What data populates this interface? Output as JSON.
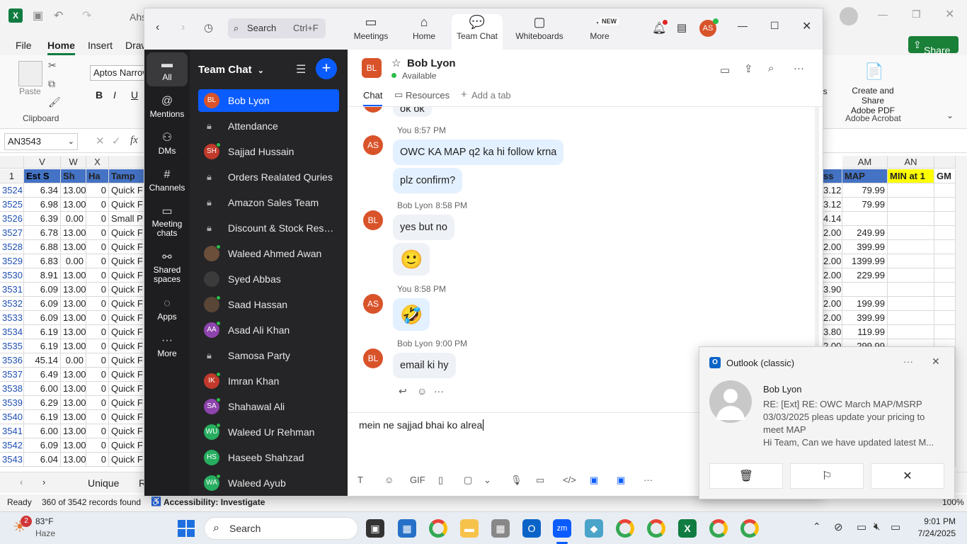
{
  "excel": {
    "title_fragment": "Ahs",
    "tabs": [
      "File",
      "Home",
      "Insert",
      "Draw"
    ],
    "font_name": "Aptos Narrow",
    "clipboard_label": "Clipboard",
    "paste_label": "Paste",
    "name_box": "AN3543",
    "fx_label": "fx",
    "share_label": "Share",
    "pdf_label_1": "Create and Share",
    "pdf_label_2": "Adobe PDF",
    "adobe_group": "Adobe Acrobat",
    "ribbon_right_fragment": "ls",
    "columns_left": [
      "V",
      "W",
      "X"
    ],
    "columns_right": [
      "AM",
      "AN"
    ],
    "header_row_num": "1",
    "headers_left": [
      "Est S",
      "Sh",
      "Ha",
      "Tamp"
    ],
    "headers_right": [
      "ss",
      "MAP",
      "MIN at 1",
      "GM"
    ],
    "rows": [
      {
        "n": "3524",
        "v": "6.34",
        "w": "13.00",
        "x": "0",
        "t": "Quick F",
        "r": "3.12",
        "map": "79.99"
      },
      {
        "n": "3525",
        "v": "6.98",
        "w": "13.00",
        "x": "0",
        "t": "Quick F",
        "r": "3.12",
        "map": "79.99"
      },
      {
        "n": "3526",
        "v": "6.39",
        "w": "0.00",
        "x": "0",
        "t": "Small P",
        "r": "4.14",
        "map": ""
      },
      {
        "n": "3527",
        "v": "6.78",
        "w": "13.00",
        "x": "0",
        "t": "Quick F",
        "r": "2.00",
        "map": "249.99"
      },
      {
        "n": "3528",
        "v": "6.88",
        "w": "13.00",
        "x": "0",
        "t": "Quick F",
        "r": "2.00",
        "map": "399.99"
      },
      {
        "n": "3529",
        "v": "6.83",
        "w": "0.00",
        "x": "0",
        "t": "Quick F",
        "r": "2.00",
        "map": "1399.99"
      },
      {
        "n": "3530",
        "v": "8.91",
        "w": "13.00",
        "x": "0",
        "t": "Quick F",
        "r": "2.00",
        "map": "229.99"
      },
      {
        "n": "3531",
        "v": "6.09",
        "w": "13.00",
        "x": "0",
        "t": "Quick F",
        "r": "3.90",
        "map": ""
      },
      {
        "n": "3532",
        "v": "6.09",
        "w": "13.00",
        "x": "0",
        "t": "Quick F",
        "r": "2.00",
        "map": "199.99"
      },
      {
        "n": "3533",
        "v": "6.09",
        "w": "13.00",
        "x": "0",
        "t": "Quick F",
        "r": "2.00",
        "map": "399.99"
      },
      {
        "n": "3534",
        "v": "6.19",
        "w": "13.00",
        "x": "0",
        "t": "Quick F",
        "r": "3.80",
        "map": "119.99"
      },
      {
        "n": "3535",
        "v": "6.19",
        "w": "13.00",
        "x": "0",
        "t": "Quick F",
        "r": "2.00",
        "map": "299.99"
      },
      {
        "n": "3536",
        "v": "45.14",
        "w": "0.00",
        "x": "0",
        "t": "Quick F",
        "r": "",
        "map": ""
      },
      {
        "n": "3537",
        "v": "6.49",
        "w": "13.00",
        "x": "0",
        "t": "Quick F",
        "r": "",
        "map": ""
      },
      {
        "n": "3538",
        "v": "6.00",
        "w": "13.00",
        "x": "0",
        "t": "Quick F",
        "r": "",
        "map": ""
      },
      {
        "n": "3539",
        "v": "6.29",
        "w": "13.00",
        "x": "0",
        "t": "Quick F",
        "r": "",
        "map": ""
      },
      {
        "n": "3540",
        "v": "6.19",
        "w": "13.00",
        "x": "0",
        "t": "Quick F",
        "r": "",
        "map": ""
      },
      {
        "n": "3541",
        "v": "6.00",
        "w": "13.00",
        "x": "0",
        "t": "Quick F",
        "r": "",
        "map": ""
      },
      {
        "n": "3542",
        "v": "6.09",
        "w": "13.00",
        "x": "0",
        "t": "Quick F",
        "r": "",
        "map": ""
      },
      {
        "n": "3543",
        "v": "6.04",
        "w": "13.00",
        "x": "0",
        "t": "Quick F",
        "r": "",
        "map": ""
      }
    ],
    "sheet_tab_1": "Unique",
    "sheet_tab_2": "R",
    "status_ready": "Ready",
    "status_records": "360 of 3542 records found",
    "status_accessibility": "Accessibility: Investigate",
    "zoom_level": "100%"
  },
  "zoom": {
    "search_label": "Search",
    "search_shortcut": "Ctrl+F",
    "nav": [
      {
        "label": "Meetings",
        "icon": "video-icon"
      },
      {
        "label": "Home",
        "icon": "home-icon"
      },
      {
        "label": "Team Chat",
        "icon": "chat-icon"
      },
      {
        "label": "Whiteboards",
        "icon": "whiteboard-icon"
      },
      {
        "label": "More",
        "icon": "more-icon"
      }
    ],
    "new_badge": "NEW",
    "user_initials": "AS",
    "rail": [
      {
        "label": "All"
      },
      {
        "label": "Mentions"
      },
      {
        "label": "DMs"
      },
      {
        "label": "Channels"
      },
      {
        "label": "Meeting chats"
      },
      {
        "label": "Shared spaces"
      },
      {
        "label": "Apps"
      },
      {
        "label": "More"
      }
    ],
    "chat_header": "Team Chat",
    "chats": [
      {
        "name": "Bob Lyon",
        "type": "avatar",
        "initials": "BL",
        "color": "#d9532a",
        "online": false
      },
      {
        "name": "Attendance",
        "type": "lock"
      },
      {
        "name": "Sajjad Hussain",
        "type": "avatar",
        "initials": "SH",
        "color": "#c0392b",
        "online": true
      },
      {
        "name": "Orders Realated Quries",
        "type": "lock"
      },
      {
        "name": "Amazon Sales Team",
        "type": "lock"
      },
      {
        "name": "Discount & Stock Reser...",
        "type": "lock"
      },
      {
        "name": "Waleed Ahmed Awan",
        "type": "photo",
        "color": "#6b4f3a",
        "online": true
      },
      {
        "name": "Syed Abbas",
        "type": "photo",
        "color": "#3b3b3b",
        "online": false
      },
      {
        "name": "Saad Hassan",
        "type": "photo",
        "color": "#5a4636",
        "online": true
      },
      {
        "name": "Asad Ali Khan",
        "type": "avatar",
        "initials": "AA",
        "color": "#8e44ad",
        "online": true
      },
      {
        "name": "Samosa Party",
        "type": "lock"
      },
      {
        "name": "Imran Khan",
        "type": "avatar",
        "initials": "IK",
        "color": "#c0392b",
        "online": true
      },
      {
        "name": "Shahawal Ali",
        "type": "avatar",
        "initials": "SA",
        "color": "#8e44ad",
        "online": true
      },
      {
        "name": "Waleed Ur Rehman",
        "type": "avatar",
        "initials": "WU",
        "color": "#27ae60",
        "online": true
      },
      {
        "name": "Haseeb Shahzad",
        "type": "avatar",
        "initials": "HS",
        "color": "#27ae60",
        "online": false
      },
      {
        "name": "Waleed Ayub",
        "type": "avatar",
        "initials": "WA",
        "color": "#27ae60",
        "online": true
      }
    ],
    "conv_name": "Bob Lyon",
    "conv_initials": "BL",
    "conv_status": "Available",
    "conv_tabs": [
      "Chat",
      "Resources",
      "Add a tab"
    ],
    "messages": [
      {
        "kind": "partial",
        "text": "ok ok"
      },
      {
        "kind": "header",
        "who": "AS",
        "sender": "You",
        "time": "8:57 PM"
      },
      {
        "kind": "bubble",
        "mine": true,
        "text": "OWC KA MAP q2 ka hi follow krna"
      },
      {
        "kind": "bubble",
        "mine": true,
        "text": "plz confirm?"
      },
      {
        "kind": "header",
        "who": "BL",
        "sender": "Bob Lyon",
        "time": "8:58 PM"
      },
      {
        "kind": "bubble",
        "mine": false,
        "text": "yes but no"
      },
      {
        "kind": "emoji",
        "mine": false,
        "text": "🙂"
      },
      {
        "kind": "header",
        "who": "AS",
        "sender": "You",
        "time": "8:58 PM"
      },
      {
        "kind": "emoji",
        "mine": true,
        "text": "🤣"
      },
      {
        "kind": "header",
        "who": "BL",
        "sender": "Bob Lyon",
        "time": "9:00 PM"
      },
      {
        "kind": "bubble",
        "mine": false,
        "text": "email ki hy"
      }
    ],
    "compose_text": "mein ne sajjad bhai ko alrea",
    "compose_tools": [
      "T",
      "☺",
      "GIF",
      "▯",
      "▢",
      "⌄",
      "🎙",
      "▭",
      "</>",
      "▣",
      "▣",
      "···"
    ]
  },
  "toast": {
    "app": "Outlook (classic)",
    "sender": "Bob Lyon",
    "line1": "RE: [Ext] RE: OWC March MAP/MSRP",
    "line2": "03/03/2025 pleas update your pricing to",
    "line3": "meet MAP",
    "line4": "Hi Team,  Can we have updated latest M..."
  },
  "taskbar": {
    "weather_temp": "83°F",
    "weather_desc": "Haze",
    "weather_badge": "2",
    "search_label": "Search",
    "time": "9:01 PM",
    "date": "7/24/2025"
  }
}
